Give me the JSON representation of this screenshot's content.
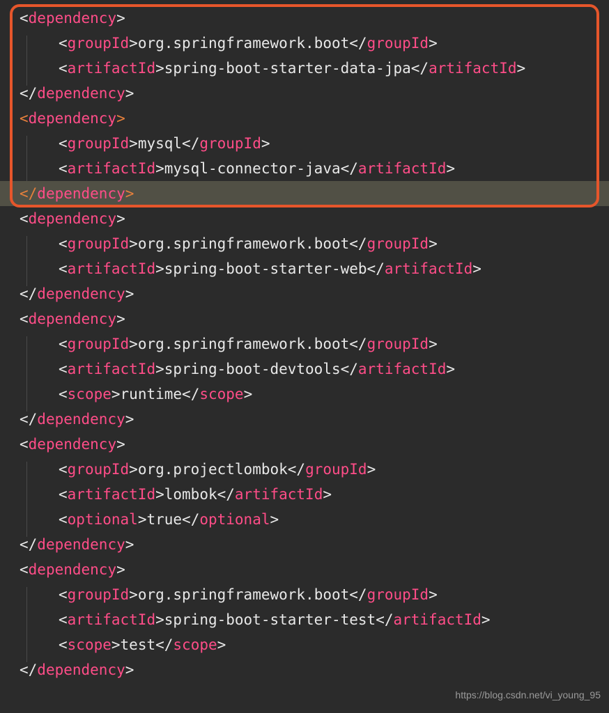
{
  "watermark": "https://blog.csdn.net/vi_young_95",
  "tags": {
    "dependency": "dependency",
    "groupId": "groupId",
    "artifactId": "artifactId",
    "scope": "scope",
    "optional": "optional"
  },
  "deps": [
    {
      "groupId": "org.springframework.boot",
      "artifactId": "spring-boot-starter-data-jpa"
    },
    {
      "groupId": "mysql",
      "artifactId": "mysql-connector-java"
    },
    {
      "groupId": "org.springframework.boot",
      "artifactId": "spring-boot-starter-web"
    },
    {
      "groupId": "org.springframework.boot",
      "artifactId": "spring-boot-devtools",
      "scope": "runtime"
    },
    {
      "groupId": "org.projectlombok",
      "artifactId": "lombok",
      "optional": "true"
    },
    {
      "groupId": "org.springframework.boot",
      "artifactId": "spring-boot-starter-test",
      "scope": "test"
    }
  ]
}
